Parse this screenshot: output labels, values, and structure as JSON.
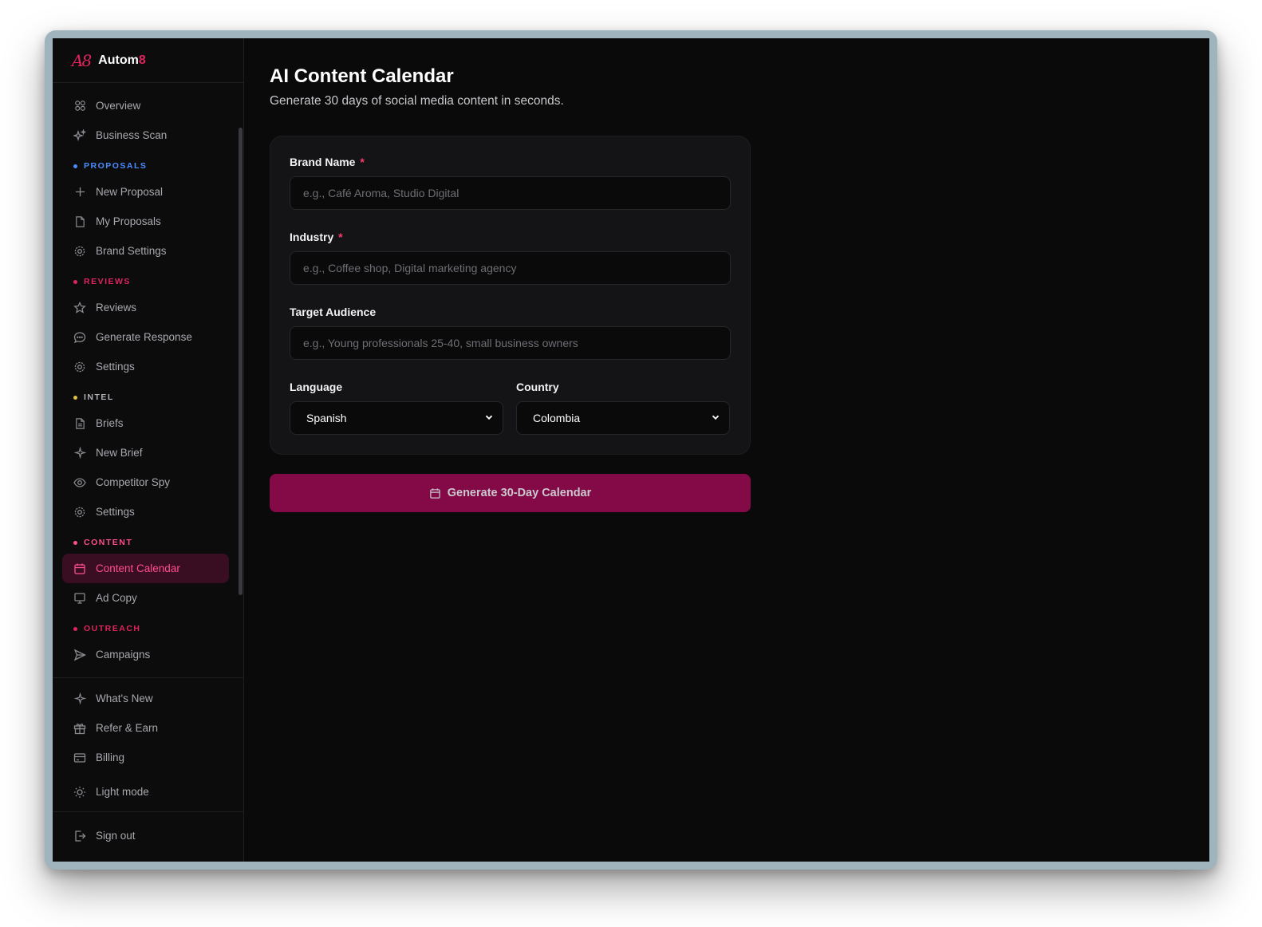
{
  "brand": {
    "logo": "A8",
    "name_main": "Autom",
    "name_accent": "8"
  },
  "nav": {
    "top": [
      {
        "label": "Overview",
        "icon": "grid-icon"
      },
      {
        "label": "Business Scan",
        "icon": "sparkles-icon"
      }
    ],
    "sections": [
      {
        "title": "PROPOSALS",
        "color": "#4a8cff",
        "items": [
          {
            "label": "New Proposal",
            "icon": "plus-icon"
          },
          {
            "label": "My Proposals",
            "icon": "file-icon"
          },
          {
            "label": "Brand Settings",
            "icon": "gear-icon"
          }
        ]
      },
      {
        "title": "REVIEWS",
        "color": "#e0245e",
        "items": [
          {
            "label": "Reviews",
            "icon": "star-icon"
          },
          {
            "label": "Generate Response",
            "icon": "chat-icon"
          },
          {
            "label": "Settings",
            "icon": "gear-icon"
          }
        ]
      },
      {
        "title": "INTEL",
        "color": "#b0b0b6",
        "items": [
          {
            "label": "Briefs",
            "icon": "document-icon"
          },
          {
            "label": "New Brief",
            "icon": "sparkle-icon"
          },
          {
            "label": "Competitor Spy",
            "icon": "eye-icon"
          },
          {
            "label": "Settings",
            "icon": "gear-icon"
          }
        ]
      },
      {
        "title": "CONTENT",
        "color": "#ff4d8d",
        "items": [
          {
            "label": "Content Calendar",
            "icon": "calendar-icon",
            "active": true
          },
          {
            "label": "Ad Copy",
            "icon": "monitor-icon"
          }
        ]
      },
      {
        "title": "OUTREACH",
        "color": "#e0245e",
        "items": [
          {
            "label": "Campaigns",
            "icon": "send-icon"
          }
        ]
      }
    ],
    "bottom": [
      {
        "label": "What's New",
        "icon": "sparkle-icon"
      },
      {
        "label": "Refer & Earn",
        "icon": "gift-icon"
      },
      {
        "label": "Billing",
        "icon": "credit-card-icon"
      },
      {
        "label": "Light mode",
        "icon": "sun-icon"
      }
    ],
    "signout": {
      "label": "Sign out",
      "icon": "logout-icon"
    }
  },
  "main": {
    "title": "AI Content Calendar",
    "subtitle": "Generate 30 days of social media content in seconds.",
    "form": {
      "brand_name": {
        "label": "Brand Name",
        "required": "*",
        "placeholder": "e.g., Café Aroma, Studio Digital",
        "value": ""
      },
      "industry": {
        "label": "Industry",
        "required": "*",
        "placeholder": "e.g., Coffee shop, Digital marketing agency",
        "value": ""
      },
      "target_audience": {
        "label": "Target Audience",
        "placeholder": "e.g., Young professionals 25-40, small business owners",
        "value": ""
      },
      "language": {
        "label": "Language",
        "selected": "Spanish"
      },
      "country": {
        "label": "Country",
        "selected": "Colombia"
      }
    },
    "generate_button": {
      "label": "Generate 30-Day Calendar",
      "icon": "calendar-icon"
    }
  },
  "colors": {
    "accent": "#e0245e",
    "active_text": "#ff4d8d",
    "button_bg": "#840a47",
    "background": "#0a0a0a"
  }
}
